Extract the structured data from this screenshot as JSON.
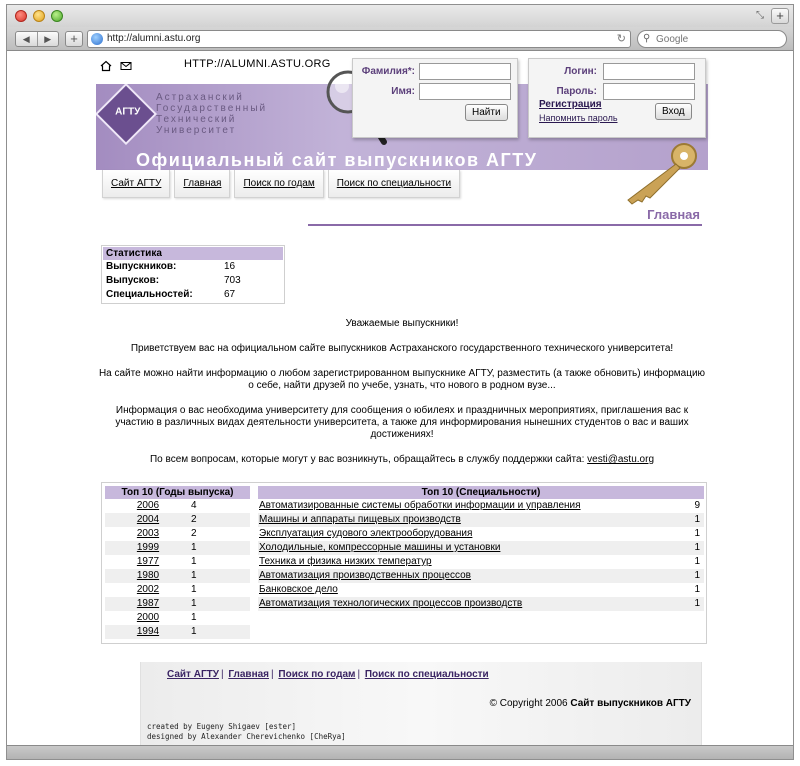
{
  "browser": {
    "url": "http://alumni.astu.org",
    "search_placeholder": "Google"
  },
  "header": {
    "site_url": "HTTP://ALUMNI.ASTU.ORG",
    "logo_text": "АГТУ",
    "university_lines": [
      "Астраханский",
      "Государственный",
      "Технический",
      "Университет"
    ],
    "official_title": "Официальный сайт выпускников АГТУ"
  },
  "search_form": {
    "surname_label": "Фамилия*:",
    "name_label": "Имя:",
    "find_button": "Найти"
  },
  "login_form": {
    "login_label": "Логин:",
    "password_label": "Пароль:",
    "register_link": "Регистрация",
    "remind_link": "Напомнить пароль",
    "enter_button": "Вход"
  },
  "nav": {
    "tabs": [
      "Сайт АГТУ",
      "Главная",
      "Поиск по годам",
      "Поиск по специальности"
    ]
  },
  "page_title": "Главная",
  "stats": {
    "title": "Статистика",
    "rows": [
      {
        "label": "Выпускников:",
        "value": "16"
      },
      {
        "label": "Выпусков:",
        "value": "703"
      },
      {
        "label": "Специальностей:",
        "value": "67"
      }
    ]
  },
  "welcome": {
    "greeting": "Уважаемые выпускники!",
    "p1": "Приветствуем вас на официальном сайте выпускников Астраханского государственного технического университета!",
    "p2": "На сайте можно найти информацию о любом зарегистрированном выпускнике АГТУ, разместить (а также обновить) информацию о себе, найти друзей по учебе, узнать, что нового в родном вузе...",
    "p3": "Информация о вас необходима университету для сообщения о юбилеях и праздничных мероприятиях, приглашения вас к участию в различных видах деятельности университета, а также для информирования нынешних студентов о вас и ваших достижениях!",
    "p4": "По всем вопросам, которые могут у вас возникнуть, обращайтесь в службу поддержки сайта:",
    "email": "vesti@astu.org"
  },
  "top_years": {
    "title": "Топ 10 (Годы выпуска)",
    "rows": [
      {
        "year": "2006",
        "count": "4"
      },
      {
        "year": "2004",
        "count": "2"
      },
      {
        "year": "2003",
        "count": "2"
      },
      {
        "year": "1999",
        "count": "1"
      },
      {
        "year": "1977",
        "count": "1"
      },
      {
        "year": "1980",
        "count": "1"
      },
      {
        "year": "2002",
        "count": "1"
      },
      {
        "year": "1987",
        "count": "1"
      },
      {
        "year": "2000",
        "count": "1"
      },
      {
        "year": "1994",
        "count": "1"
      }
    ]
  },
  "top_specs": {
    "title": "Топ 10 (Специальности)",
    "rows": [
      {
        "name": "Автоматизированные системы обработки информации и управления",
        "count": "9"
      },
      {
        "name": "Машины и аппараты пищевых производств",
        "count": "1"
      },
      {
        "name": "Эксплуатация судового электрооборудования",
        "count": "1"
      },
      {
        "name": "Холодильные, компрессорные машины и установки",
        "count": "1"
      },
      {
        "name": "Техника и физика низких температур",
        "count": "1"
      },
      {
        "name": "Автоматизация производственных процессов",
        "count": "1"
      },
      {
        "name": "Банковское дело",
        "count": "1"
      },
      {
        "name": "Автоматизация технологических процессов производств",
        "count": "1"
      }
    ]
  },
  "footer": {
    "links": [
      "Сайт АГТУ",
      "Главная",
      "Поиск по годам",
      "Поиск по специальности"
    ],
    "copyright_prefix": "© Copyright 2006",
    "copyright_site": "Сайт выпускников АГТУ",
    "credit_1": "created by Eugeny Shigaev [ester]",
    "credit_2": "designed by Alexander Cherevichenko [CheRya]"
  },
  "colors": {
    "accent": "#8a6aa8",
    "header_bg": "#c7b8dc",
    "link": "#3a2463"
  }
}
